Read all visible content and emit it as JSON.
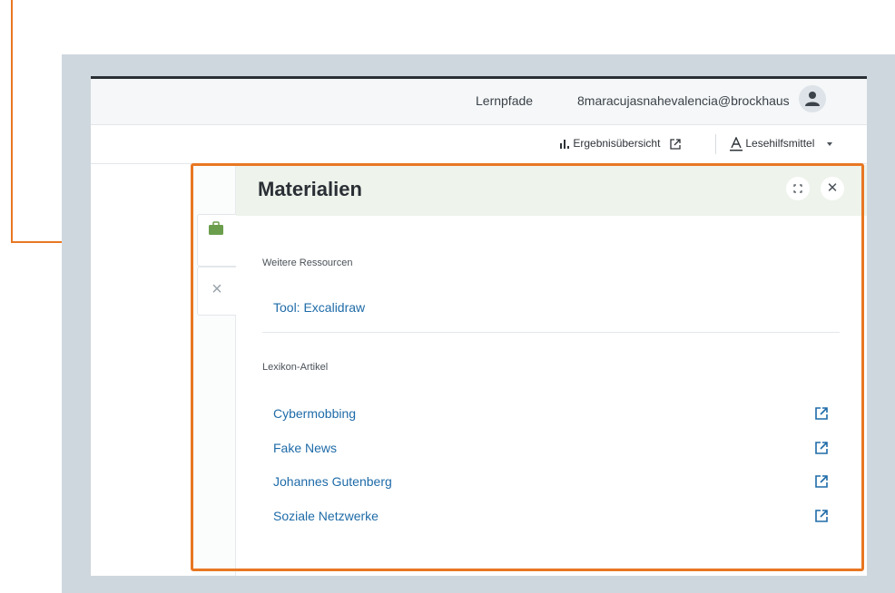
{
  "header": {
    "nav_link": "Lernpfade",
    "user_email": "8maracujasnahevalencia@brockhaus",
    "avatar_icon": "user-icon"
  },
  "toolbar": {
    "results_label": "Ergebnisübersicht",
    "results_icon": "bar-chart-icon",
    "results_ext_icon": "external-link-icon",
    "reading_aids_label": "Lesehilfsmittel",
    "reading_aids_icon": "text-underline-icon",
    "reading_aids_dropdown_icon": "caret-down-icon"
  },
  "panel": {
    "title": "Materialien",
    "tab_icon": "briefcase-icon",
    "close_tab_icon": "close-icon",
    "expand_icon": "expand-icon",
    "close_icon": "close-icon",
    "resources_heading": "Weitere Ressourcen",
    "resources": [
      {
        "label": "Tool: Excalidraw"
      }
    ],
    "lexicon_heading": "Lexikon-Artikel",
    "lexicon_articles": [
      {
        "label": "Cybermobbing"
      },
      {
        "label": "Fake News"
      },
      {
        "label": "Johannes Gutenberg"
      },
      {
        "label": "Soziale Netzwerke"
      }
    ]
  },
  "colors": {
    "accent_orange": "#e87722",
    "link_blue": "#1e6ba8",
    "panel_header_green": "#eef3ec",
    "tab_icon_green": "#6a9e4c"
  }
}
